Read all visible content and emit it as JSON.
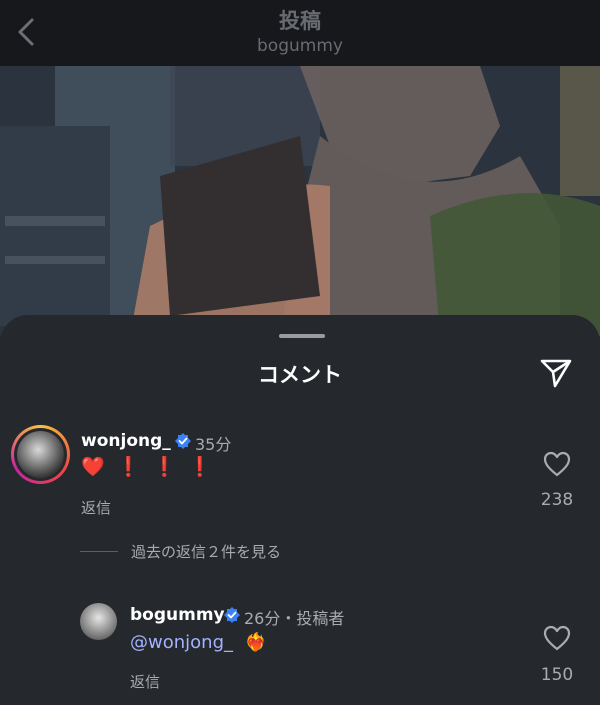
{
  "header": {
    "title": "投稿",
    "subtitle": "bogummy"
  },
  "sheet": {
    "title": "コメント"
  },
  "comment": {
    "username": "wonjong_",
    "time": "35分",
    "emojis": [
      "❤️",
      "❗",
      "❗",
      "❗"
    ],
    "reply_label": "返信",
    "likes": "238"
  },
  "view_replies": "過去の返信２件を見る",
  "reply": {
    "username": "bogummy",
    "time": "26分・投稿者",
    "mention": "@wonjong_",
    "emoji": "❤️‍🔥",
    "reply_label": "返信",
    "likes": "150"
  },
  "colors": {
    "mention": "#a4b2ff",
    "verified": "#3b82f6",
    "sheet": "#25282d",
    "header": "#16181c"
  }
}
